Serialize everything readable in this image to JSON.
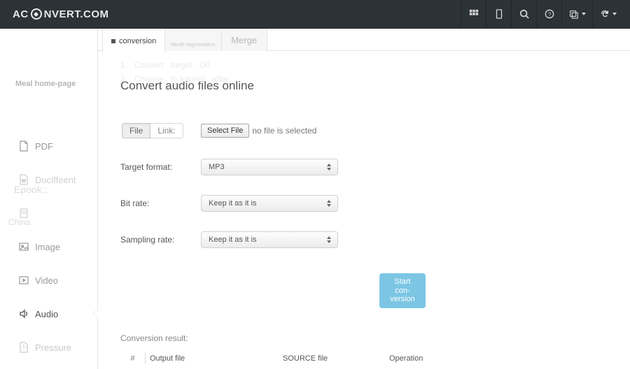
{
  "brand": {
    "left": "AC",
    "right": "NVERT.COM"
  },
  "topbar_icons": {
    "grid": "grid-icon",
    "mobile": "mobile-icon",
    "search": "search-icon",
    "help": "help-icon",
    "lang": "language-icon",
    "refresh": "refresh-icon"
  },
  "sidebar": {
    "home_label": "Meal home-page",
    "ghosts": {
      "book": "Epook:;",
      "china": "China"
    },
    "items": [
      {
        "label": "PDF"
      },
      {
        "label": "DocIlfeent"
      },
      {
        "label": ""
      },
      {
        "label": "Image"
      },
      {
        "label": "Video"
      },
      {
        "label": "Audio"
      },
      {
        "label": "Pressure"
      }
    ]
  },
  "tabs": {
    "conversion": "conversion",
    "seg_sub": "Mouth segmentation",
    "merge": "Merge"
  },
  "ghost_lines": {
    "l1": "1.   Convert   target   Oil",
    "l2": "2.   Choose   to tutorial   after"
  },
  "page": {
    "title": "Convert audio files online"
  },
  "filelink": {
    "file": "File",
    "link": "Link:"
  },
  "file_select": {
    "button": "Select File",
    "status": "no file is selected"
  },
  "labels": {
    "target": "Target format:",
    "bitrate": "Bit rate:",
    "sampling": "Sampling rate:"
  },
  "selects": {
    "target_value": "MP3",
    "bitrate_value": "Keep it as it is",
    "sampling_value": "Keep it as it is"
  },
  "actions": {
    "start": "Start con-version"
  },
  "result": {
    "label": "Conversion result:",
    "cols": {
      "num": "#",
      "out": "Output file",
      "src": "SOURCE file",
      "op": "Operation"
    }
  }
}
